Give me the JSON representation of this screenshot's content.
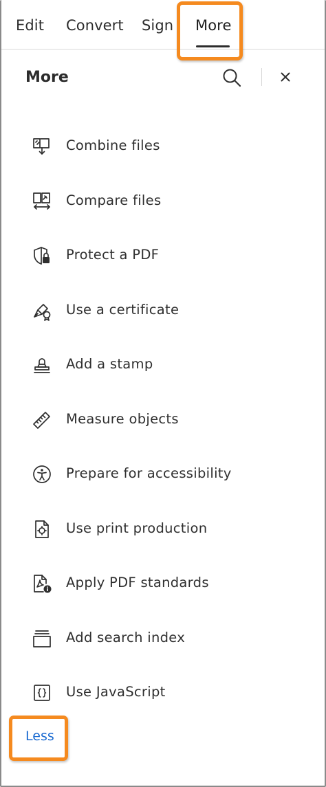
{
  "tabs": {
    "edit": "Edit",
    "convert": "Convert",
    "sign": "Sign",
    "more": "More"
  },
  "panel": {
    "title": "More",
    "search_icon": "search-icon",
    "close_icon": "close-icon"
  },
  "tools": [
    {
      "label": "Combine files",
      "icon": "combine-files-icon"
    },
    {
      "label": "Compare files",
      "icon": "compare-files-icon"
    },
    {
      "label": "Protect a PDF",
      "icon": "shield-lock-icon"
    },
    {
      "label": "Use a certificate",
      "icon": "certificate-pen-icon"
    },
    {
      "label": "Add a stamp",
      "icon": "stamp-icon"
    },
    {
      "label": "Measure objects",
      "icon": "ruler-icon"
    },
    {
      "label": "Prepare for accessibility",
      "icon": "accessibility-icon"
    },
    {
      "label": "Use print production",
      "icon": "print-production-icon"
    },
    {
      "label": "Apply PDF standards",
      "icon": "pdf-standards-icon"
    },
    {
      "label": "Add search index",
      "icon": "search-index-icon"
    },
    {
      "label": "Use JavaScript",
      "icon": "javascript-icon"
    }
  ],
  "less_label": "Less",
  "colors": {
    "highlight": "#f58a1f",
    "link": "#1a6ad1",
    "text": "#2c2c2c"
  }
}
